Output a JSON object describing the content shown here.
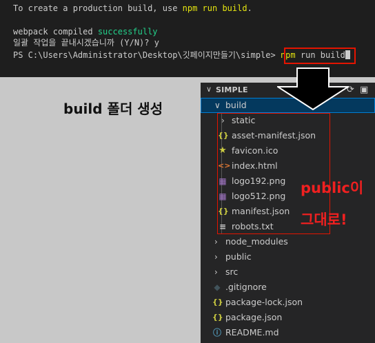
{
  "terminal": {
    "line1_pre": "To create a production build, use ",
    "line1_cmd": "npm run build",
    "line1_post": ".",
    "line2_pre": "webpack compiled ",
    "line2_status": "successfully",
    "line3": "일괄 작업을 끝내시겠습니까 (Y/N)? y",
    "prompt_path": "PS C:\\Users\\Administrator\\Desktop\\깃페이지만들기\\simple>",
    "prompt_cmd_npm": "npm",
    "prompt_cmd_rest": " run build"
  },
  "annotations": {
    "build_folder": "build 폴더 생성",
    "public_as_is_1": "public이",
    "public_as_is_2": "그대로!"
  },
  "explorer": {
    "title": "SIMPLE",
    "build_folder": "build",
    "build_children": [
      {
        "label": "static",
        "icon": "chevron-right-icon"
      },
      {
        "label": "asset-manifest.json",
        "icon": "json-icon"
      },
      {
        "label": "favicon.ico",
        "icon": "star-icon"
      },
      {
        "label": "index.html",
        "icon": "html-icon"
      },
      {
        "label": "logo192.png",
        "icon": "image-icon"
      },
      {
        "label": "logo512.png",
        "icon": "image-icon"
      },
      {
        "label": "manifest.json",
        "icon": "json-icon"
      },
      {
        "label": "robots.txt",
        "icon": "text-file-icon"
      }
    ],
    "root_items": [
      {
        "label": "node_modules",
        "icon": "chevron-right-icon"
      },
      {
        "label": "public",
        "icon": "chevron-right-icon"
      },
      {
        "label": "src",
        "icon": "chevron-right-icon"
      },
      {
        "label": ".gitignore",
        "icon": "git-icon"
      },
      {
        "label": "package-lock.json",
        "icon": "json-icon"
      },
      {
        "label": "package.json",
        "icon": "json-icon"
      },
      {
        "label": "README.md",
        "icon": "info-icon"
      }
    ]
  },
  "colors": {
    "terminal_bg": "#1e1e1e",
    "success_green": "#23d18b",
    "command_yellow": "#e5e510",
    "annotation_red": "#e51400",
    "explorer_bg": "#252526",
    "selection_bg": "#04395e"
  }
}
